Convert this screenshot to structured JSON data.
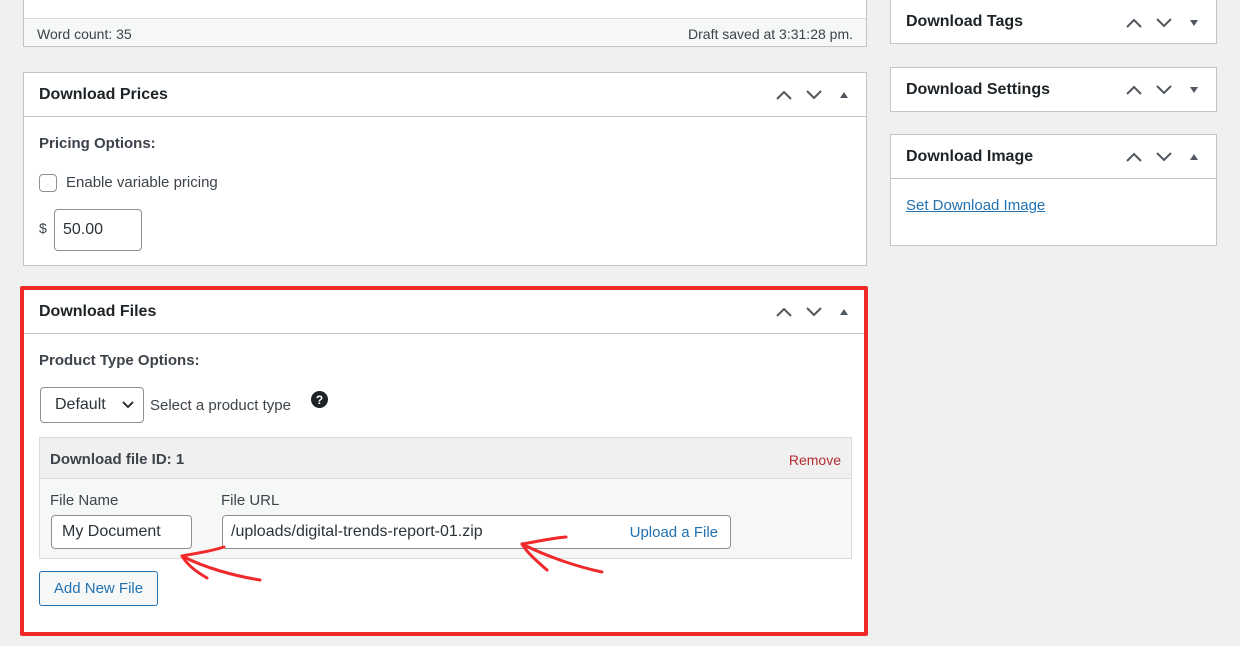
{
  "editor_status": {
    "word_count": "Word count: 35",
    "draft_saved": "Draft saved at 3:31:28 pm."
  },
  "prices_box": {
    "title": "Download Prices",
    "pricing_options_label": "Pricing Options:",
    "variable_pricing_label": "Enable variable pricing",
    "variable_pricing_checked": false,
    "currency_symbol": "$",
    "price_value": "50.00"
  },
  "files_box": {
    "title": "Download Files",
    "product_type_label": "Product Type Options:",
    "product_type_selected": "Default",
    "product_type_hint": "Select a product type",
    "help_icon_glyph": "?",
    "file_row": {
      "header": "Download file ID: 1",
      "remove_label": "Remove",
      "file_name_label": "File Name",
      "file_name_value": "My Document",
      "file_url_label": "File URL",
      "file_url_value": "/uploads/digital-trends-report-01.zip",
      "upload_label": "Upload a File"
    },
    "add_file_label": "Add New File"
  },
  "sidebar": {
    "tags_title": "Download Tags",
    "settings_title": "Download Settings",
    "image_title": "Download Image",
    "set_image_link": "Set Download Image"
  },
  "colors": {
    "highlight_border": "#f02a2a",
    "annotation_arrow": "#f02a2a",
    "link": "#2271b1",
    "remove": "#b32d2e",
    "page_bg": "#f0f0f1"
  }
}
